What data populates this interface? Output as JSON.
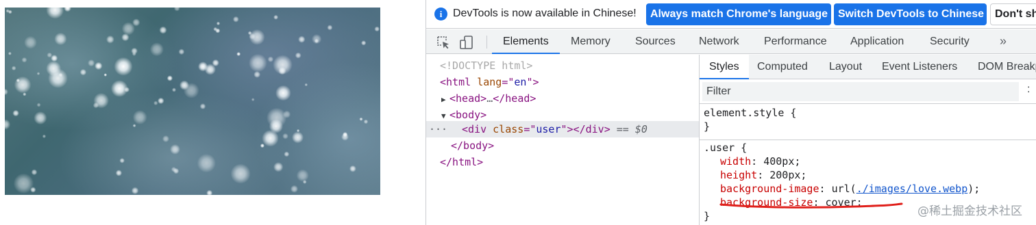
{
  "preview": {
    "description_icon": "snowy-bokeh-image"
  },
  "infobar": {
    "icon": "info-icon",
    "message": "DevTools is now available in Chinese!",
    "btn_match": "Always match Chrome's language",
    "btn_switch": "Switch DevTools to Chinese",
    "btn_dont": "Don't show again"
  },
  "toolbar": {
    "inspect_icon": "inspect-element-icon",
    "device_icon": "device-toggle-icon",
    "tabs": [
      "Elements",
      "Memory",
      "Sources",
      "Network",
      "Performance",
      "Application",
      "Security"
    ],
    "more": "»"
  },
  "dom": {
    "doctype": "<!DOCTYPE html>",
    "html_open_tag": "html",
    "html_attr": "lang",
    "html_attr_val": "en",
    "head_tag": "head",
    "ellipsis": "…",
    "body_tag": "body",
    "div_tag": "div",
    "div_attr": "class",
    "div_attr_val": "user",
    "selected_marker": "== $0",
    "row_dots": "···",
    "body_close": "</body>",
    "html_close": "</html>"
  },
  "styles": {
    "subtabs": [
      "Styles",
      "Computed",
      "Layout",
      "Event Listeners",
      "DOM Breakpoints"
    ],
    "filter_placeholder": "Filter",
    "filter_more": ":",
    "element_style_selector": "element.style {",
    "close_brace": "}",
    "user_selector": ".user {",
    "props": [
      {
        "name": "width",
        "value": "400px;"
      },
      {
        "name": "height",
        "value": "200px;"
      },
      {
        "name": "background-image",
        "value_prefix": "url(",
        "link": "./images/love.webp",
        "value_suffix": ");"
      },
      {
        "name": "background-size",
        "value": "cover;"
      }
    ]
  },
  "watermark": "@稀土掘金技术社区",
  "colors": {
    "accent": "#1a73e8",
    "annotation_red": "#e0201b"
  }
}
